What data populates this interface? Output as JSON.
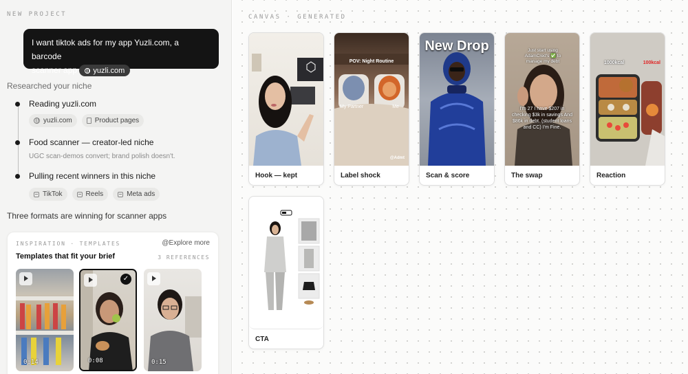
{
  "left": {
    "project_label": "NEW PROJECT",
    "user_message": {
      "text": "I want tiktok ads for my app Yuzli.com, a barcode scanner app",
      "line1": "I want tiktok ads for my app Yuzli.com, a barcode",
      "line2": "scanner app",
      "chip": "yuzli.com"
    },
    "researched_title": "Researched your niche",
    "steps": [
      {
        "title": "Reading yuzli.com",
        "chips": [
          {
            "icon": "globe-icon",
            "label": "yuzli.com"
          },
          {
            "icon": "page-icon",
            "label": "Product pages"
          }
        ]
      },
      {
        "title": "Food scanner — creator-led niche",
        "sub": "UGC scan-demos convert; brand polish doesn't."
      },
      {
        "title": "Pulling recent winners in this niche",
        "chips": [
          {
            "icon": "box-icon",
            "label": "TikTok"
          },
          {
            "icon": "box-icon",
            "label": "Reels"
          },
          {
            "icon": "box-icon",
            "label": "Meta ads"
          }
        ]
      }
    ],
    "formats_text": "Three formats are winning for scanner apps",
    "inspiration": {
      "label": "INSPIRATION · TEMPLATES",
      "explore": "@Explore more",
      "title": "Templates that fit your brief",
      "ref_count": "3 REFERENCES",
      "thumbs": [
        {
          "duration": "0:14",
          "selected": false
        },
        {
          "duration": "0:08",
          "selected": true,
          "check": "✓"
        },
        {
          "duration": "0:15",
          "selected": false
        }
      ]
    }
  },
  "canvas": {
    "label": "CANVAS · GENERATED",
    "cards": [
      {
        "label": "Hook — kept"
      },
      {
        "label": "Label shock",
        "overlay_top": "POV: Night Routine",
        "overlay_left": "My Partner",
        "overlay_right": "Me",
        "watermark": "@Admt"
      },
      {
        "label": "Scan & score",
        "overlay_title": "New Drop"
      },
      {
        "label": "The swap",
        "overlay_top": "Just start using AdamCred's ✅ to manage my debt",
        "overlay_mid": "I'm 27 I have $207 in checking $3k in savings And $86k in debt. (student loans and CC) I'm Fine."
      },
      {
        "label": "Reaction",
        "overlay_left": "1000kcal",
        "overlay_right": "100kcal"
      },
      {
        "label": "CTA"
      }
    ]
  },
  "colors": {
    "panel_bg": "#f4f4f3",
    "bubble_bg": "#141414",
    "canvas_bg": "#fbfbfa",
    "accent_red": "#e02424"
  }
}
